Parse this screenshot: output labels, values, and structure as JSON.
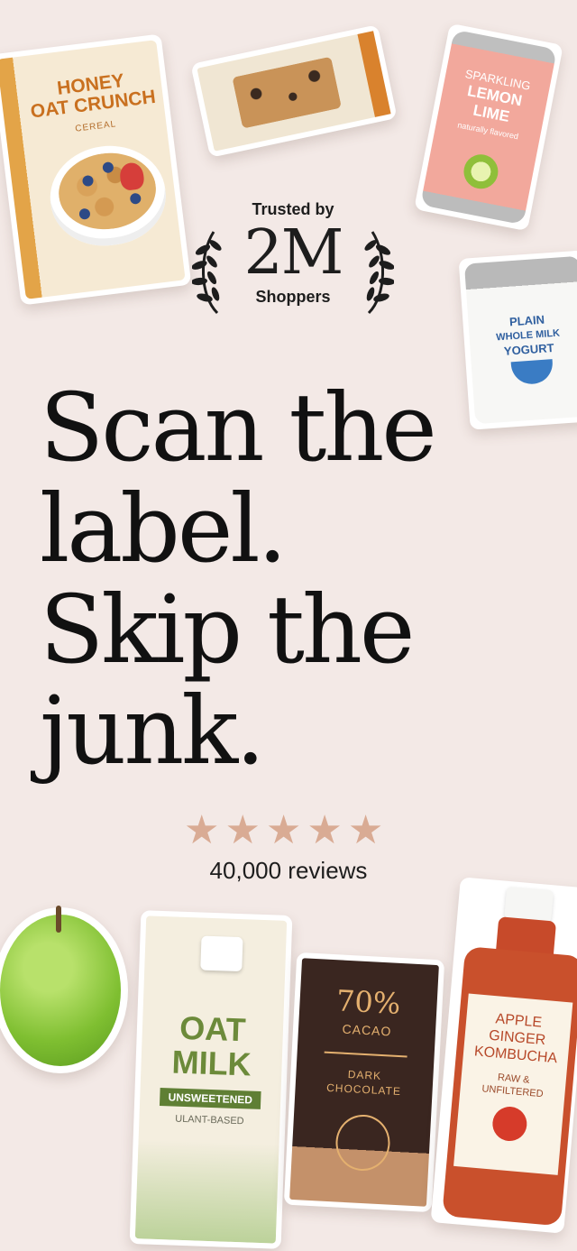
{
  "badge": {
    "top": "Trusted by",
    "value": "2M",
    "bottom": "Shoppers"
  },
  "headline": {
    "lines": [
      "Scan the",
      "label.",
      "Skip the",
      "junk."
    ]
  },
  "rating": {
    "stars": 5,
    "star_glyph": "★",
    "reviews": "40,000 reviews"
  },
  "products": {
    "cereal": {
      "line1": "HONEY",
      "line2": "OAT CRUNCH",
      "sub": "CEREAL"
    },
    "can": {
      "l1": "SPARKLING",
      "l2": "LEMON",
      "l3": "LIME",
      "l4": "naturally flavored"
    },
    "yogurt": {
      "l1": "PLAIN",
      "l2": "WHOLE MILK",
      "l3": "YOGURT"
    },
    "milk": {
      "l1": "OAT",
      "l2": "MILK",
      "tag": "UNSWEETENED",
      "sub": "ULANT-BASED"
    },
    "chocolate": {
      "pct": "70%",
      "cacao": "CACAO",
      "l1": "DARK",
      "l2": "CHOCOLATE"
    },
    "kombucha": {
      "l1": "APPLE",
      "l2": "GINGER",
      "l3": "KOMBUCHA",
      "s1": "RAW &",
      "s2": "UNFILTERED"
    }
  },
  "colors": {
    "background": "#f3e9e6",
    "star": "#d9ab94",
    "text": "#111111"
  }
}
